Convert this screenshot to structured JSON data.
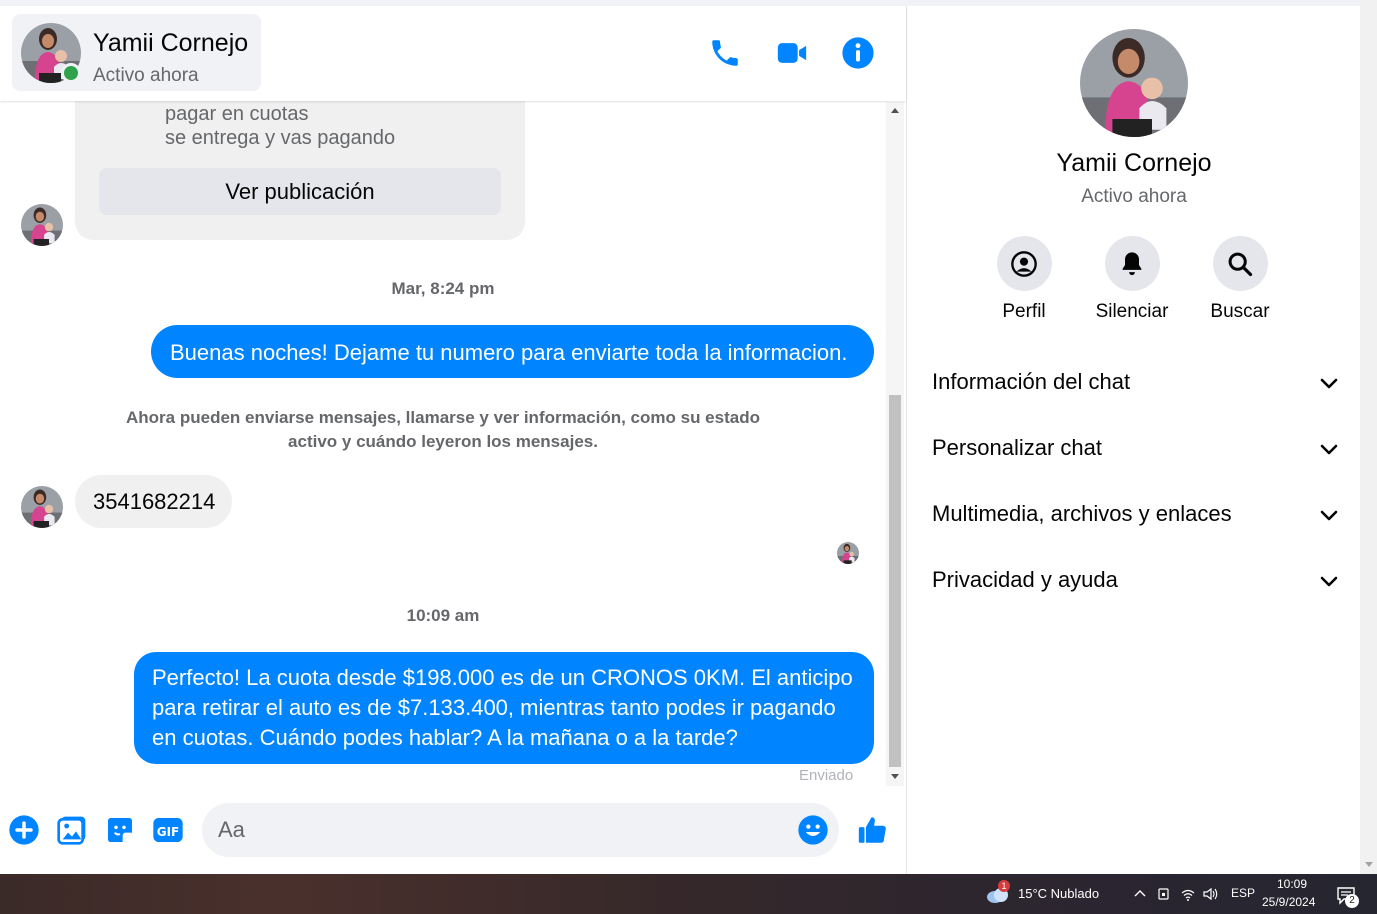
{
  "header": {
    "contact_name": "Yamii Cornejo",
    "contact_status": "Activo ahora"
  },
  "messages": {
    "post_lines": [
      "pagar en cuotas",
      "se entrega y vas pagando"
    ],
    "view_post_label": "Ver publicación",
    "timestamp_1": "Mar, 8:24 pm",
    "outgoing_1": "Buenas noches! Dejame tu numero para enviarte toda la informacion.",
    "notice_line_1": "Ahora pueden enviarse mensajes, llamarse y ver información, como su estado",
    "notice_line_2": "activo y cuándo leyeron los mensajes.",
    "incoming_1": "3541682214",
    "timestamp_2": "10:09 am",
    "outgoing_2_lines": [
      "Perfecto! La cuota desde $198.000 es de un CRONOS 0KM. El anticipo",
      "para retirar el auto es de $7.133.400, mientras tanto podes ir pagando",
      "en cuotas. Cuándo podes hablar? A la mañana o a la tarde?"
    ],
    "sent_label": "Enviado"
  },
  "composer": {
    "placeholder": "Aa"
  },
  "panel": {
    "name": "Yamii Cornejo",
    "status": "Activo ahora",
    "actions": [
      {
        "label": "Perfil",
        "icon": "profile-icon"
      },
      {
        "label": "Silenciar",
        "icon": "bell-icon"
      },
      {
        "label": "Buscar",
        "icon": "search-icon"
      }
    ],
    "sections": [
      "Información del chat",
      "Personalizar chat",
      "Multimedia, archivos y enlaces",
      "Privacidad y ayuda"
    ]
  },
  "taskbar": {
    "weather_badge": "1",
    "weather": "15°C  Nublado",
    "language": "ESP",
    "time": "10:09",
    "date": "25/9/2024",
    "notification_count": "2"
  },
  "colors": {
    "accent": "#0084ff",
    "online": "#31a24c",
    "bubble_in": "#f0f0f0",
    "secondary_text": "#65676b"
  }
}
